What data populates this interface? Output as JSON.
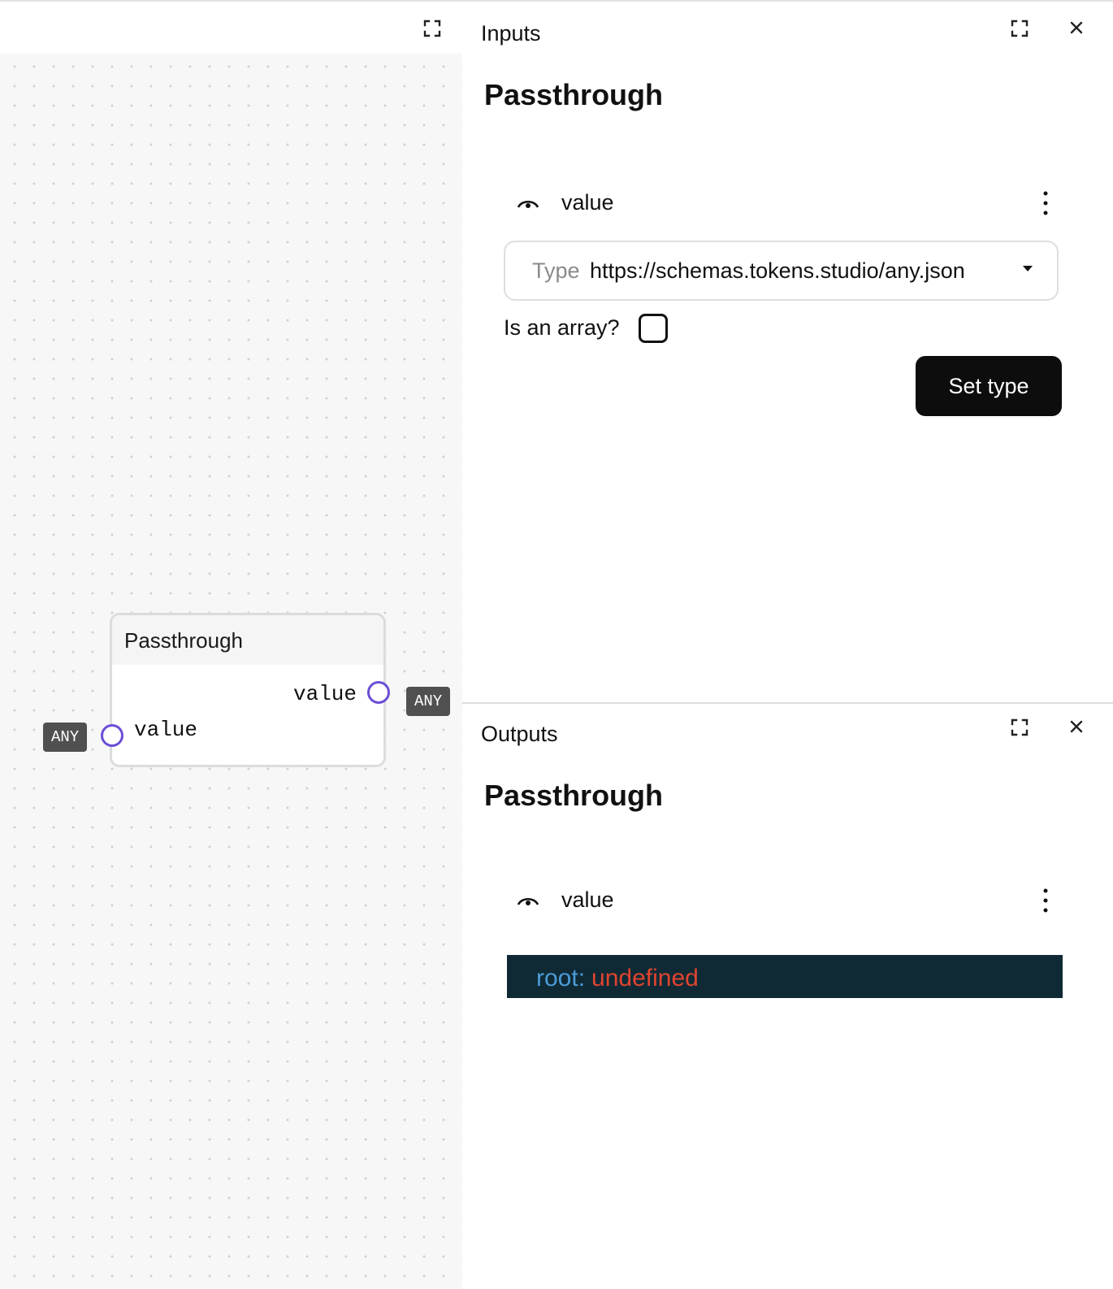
{
  "canvas": {
    "node": {
      "title": "Passthrough",
      "input_port": {
        "label": "value",
        "type": "ANY"
      },
      "output_port": {
        "label": "value",
        "type": "ANY"
      }
    },
    "icons": {
      "expand": "expand-icon"
    }
  },
  "inputs_panel": {
    "tab_label": "Inputs",
    "title": "Passthrough",
    "row": {
      "label": "value"
    },
    "type_field": {
      "label": "Type",
      "value": "https://schemas.tokens.studio/any.json"
    },
    "array_label": "Is an array?",
    "is_array": false,
    "set_type_label": "Set type",
    "icons": {
      "expand": "expand-icon",
      "close": "close-icon",
      "visibility": "eye-icon",
      "menu": "kebab-menu-icon"
    }
  },
  "outputs_panel": {
    "tab_label": "Outputs",
    "title": "Passthrough",
    "row": {
      "label": "value"
    },
    "json": {
      "key": "root:",
      "value": "undefined"
    },
    "icons": {
      "expand": "expand-icon",
      "close": "close-icon",
      "visibility": "eye-icon",
      "menu": "kebab-menu-icon"
    }
  },
  "colors": {
    "port": "#6b4fd6",
    "badge": "#505050",
    "button": "#0d0d0d",
    "json_bg": "#0f2a35",
    "json_key": "#4b9cd9",
    "json_value": "#e0442f"
  }
}
